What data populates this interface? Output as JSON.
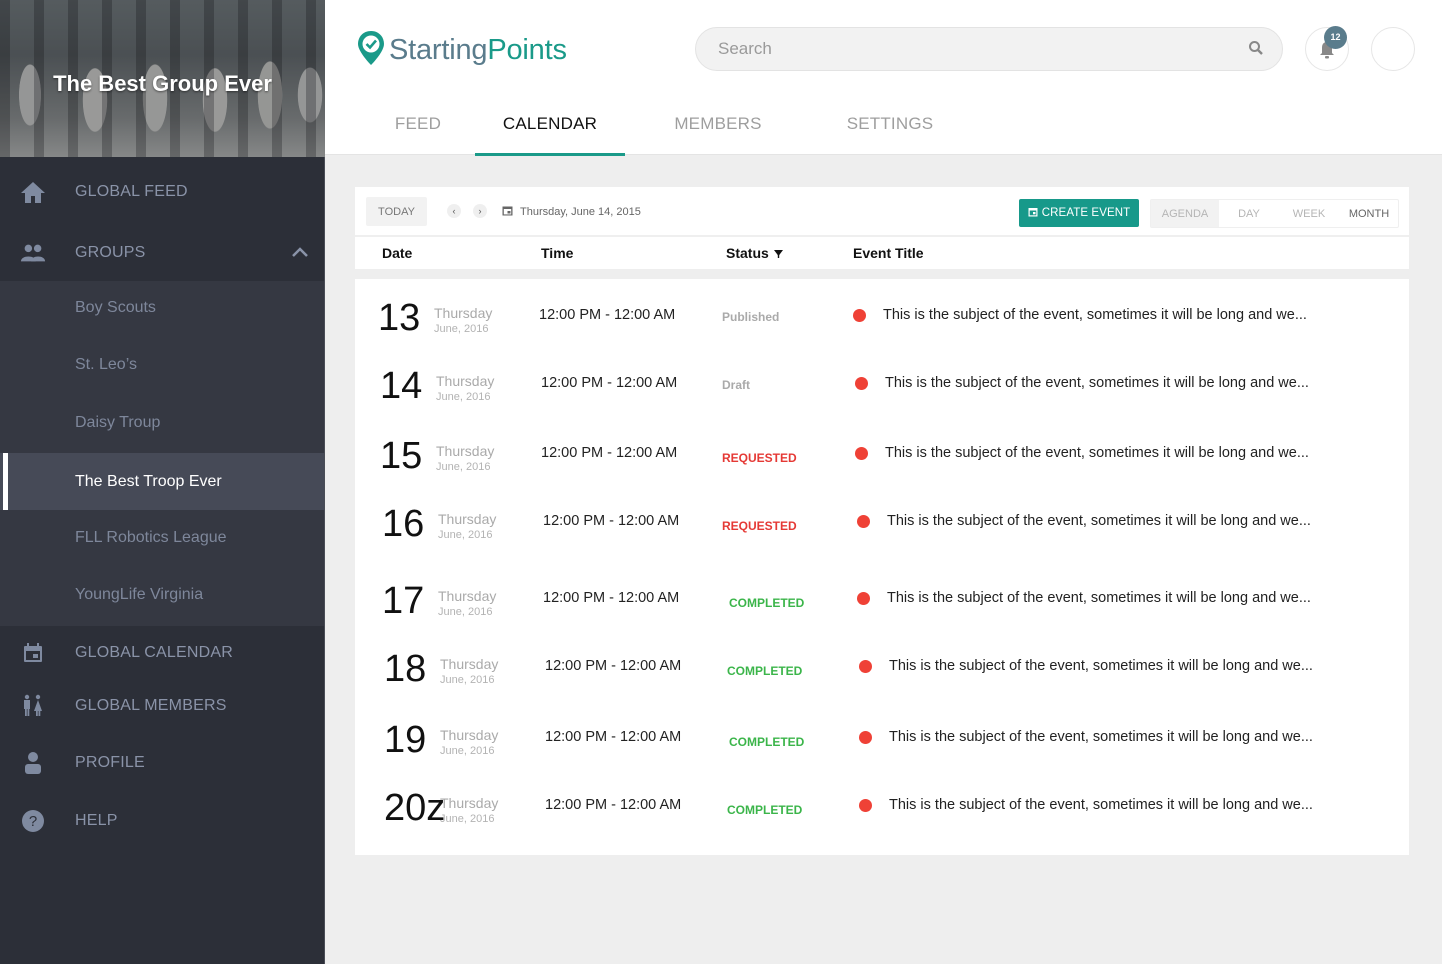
{
  "sidebar": {
    "group_title": "The Best Group Ever",
    "nav": {
      "global_feed": "GLOBAL FEED",
      "groups": "GROUPS",
      "global_calendar": "GLOBAL CALENDAR",
      "global_members": "GLOBAL MEMBERS",
      "profile": "PROFILE",
      "help": "HELP"
    },
    "groups": [
      {
        "label": "Boy Scouts",
        "active": false
      },
      {
        "label": "St. Leo’s",
        "active": false
      },
      {
        "label": "Daisy Troup",
        "active": false
      },
      {
        "label": "The Best Troop Ever",
        "active": true
      },
      {
        "label": "FLL Robotics League",
        "active": false
      },
      {
        "label": "YoungLife Virginia",
        "active": false
      }
    ]
  },
  "header": {
    "logo_part1": "Starting",
    "logo_part2": "Points",
    "search_placeholder": "Search",
    "notification_count": "12",
    "tabs": [
      {
        "label": "FEED",
        "active": false
      },
      {
        "label": "CALENDAR",
        "active": true
      },
      {
        "label": "MEMBERS",
        "active": false
      },
      {
        "label": "SETTINGS",
        "active": false
      }
    ]
  },
  "calendar": {
    "today_label": "TODAY",
    "prev_label": "‹",
    "next_label": "›",
    "current_date": "Thursday, June 14, 2015",
    "create_event_label": "CREATE EVENT",
    "views": [
      "AGENDA",
      "DAY",
      "WEEK",
      "MONTH"
    ],
    "columns": {
      "date": "Date",
      "time": "Time",
      "status": "Status",
      "title": "Event Title"
    },
    "events": [
      {
        "day": "13",
        "weekday": "Thursday",
        "month_year": "June, 2016",
        "time": "12:00 PM - 12:00 AM",
        "status": "Published",
        "status_type": "published",
        "title": "This is the subject of the event, sometimes it will be long and we..."
      },
      {
        "day": "14",
        "weekday": "Thursday",
        "month_year": "June, 2016",
        "time": "12:00 PM - 12:00 AM",
        "status": "Draft",
        "status_type": "draft",
        "title": "This is the subject of the event, sometimes it will be long and we..."
      },
      {
        "day": "15",
        "weekday": "Thursday",
        "month_year": "June, 2016",
        "time": "12:00 PM - 12:00 AM",
        "status": "REQUESTED",
        "status_type": "requested",
        "title": "This is the subject of the event, sometimes it will be long and we..."
      },
      {
        "day": "16",
        "weekday": "Thursday",
        "month_year": "June, 2016",
        "time": "12:00 PM - 12:00 AM",
        "status": "REQUESTED",
        "status_type": "requested",
        "title": "This is the subject of the event, sometimes it will be long and we..."
      },
      {
        "day": "17",
        "weekday": "Thursday",
        "month_year": "June, 2016",
        "time": "12:00 PM - 12:00 AM",
        "status": "COMPLETED",
        "status_type": "completed",
        "title": "This is the subject of the event, sometimes it will be long and we..."
      },
      {
        "day": "18",
        "weekday": "Thursday",
        "month_year": "June, 2016",
        "time": "12:00 PM - 12:00 AM",
        "status": "COMPLETED",
        "status_type": "completed",
        "title": "This is the subject of the event, sometimes it will be long and we..."
      },
      {
        "day": "19",
        "weekday": "Thursday",
        "month_year": "June, 2016",
        "time": "12:00 PM - 12:00 AM",
        "status": "COMPLETED",
        "status_type": "completed",
        "title": "This is the subject of the event, sometimes it will be long and we..."
      },
      {
        "day": "20z",
        "weekday": "Thursday",
        "month_year": "June, 2016",
        "time": "12:00 PM - 12:00 AM",
        "status": "COMPLETED",
        "status_type": "completed",
        "title": "This is the subject of the event, sometimes it will be long and we..."
      }
    ]
  },
  "colors": {
    "brand": "#1a9a89",
    "brand_secondary": "#5a7c8c",
    "requested": "#e53935",
    "completed": "#3bb54a",
    "event_dot": "#ef4136",
    "sidebar_bg": "#2c2f38"
  }
}
